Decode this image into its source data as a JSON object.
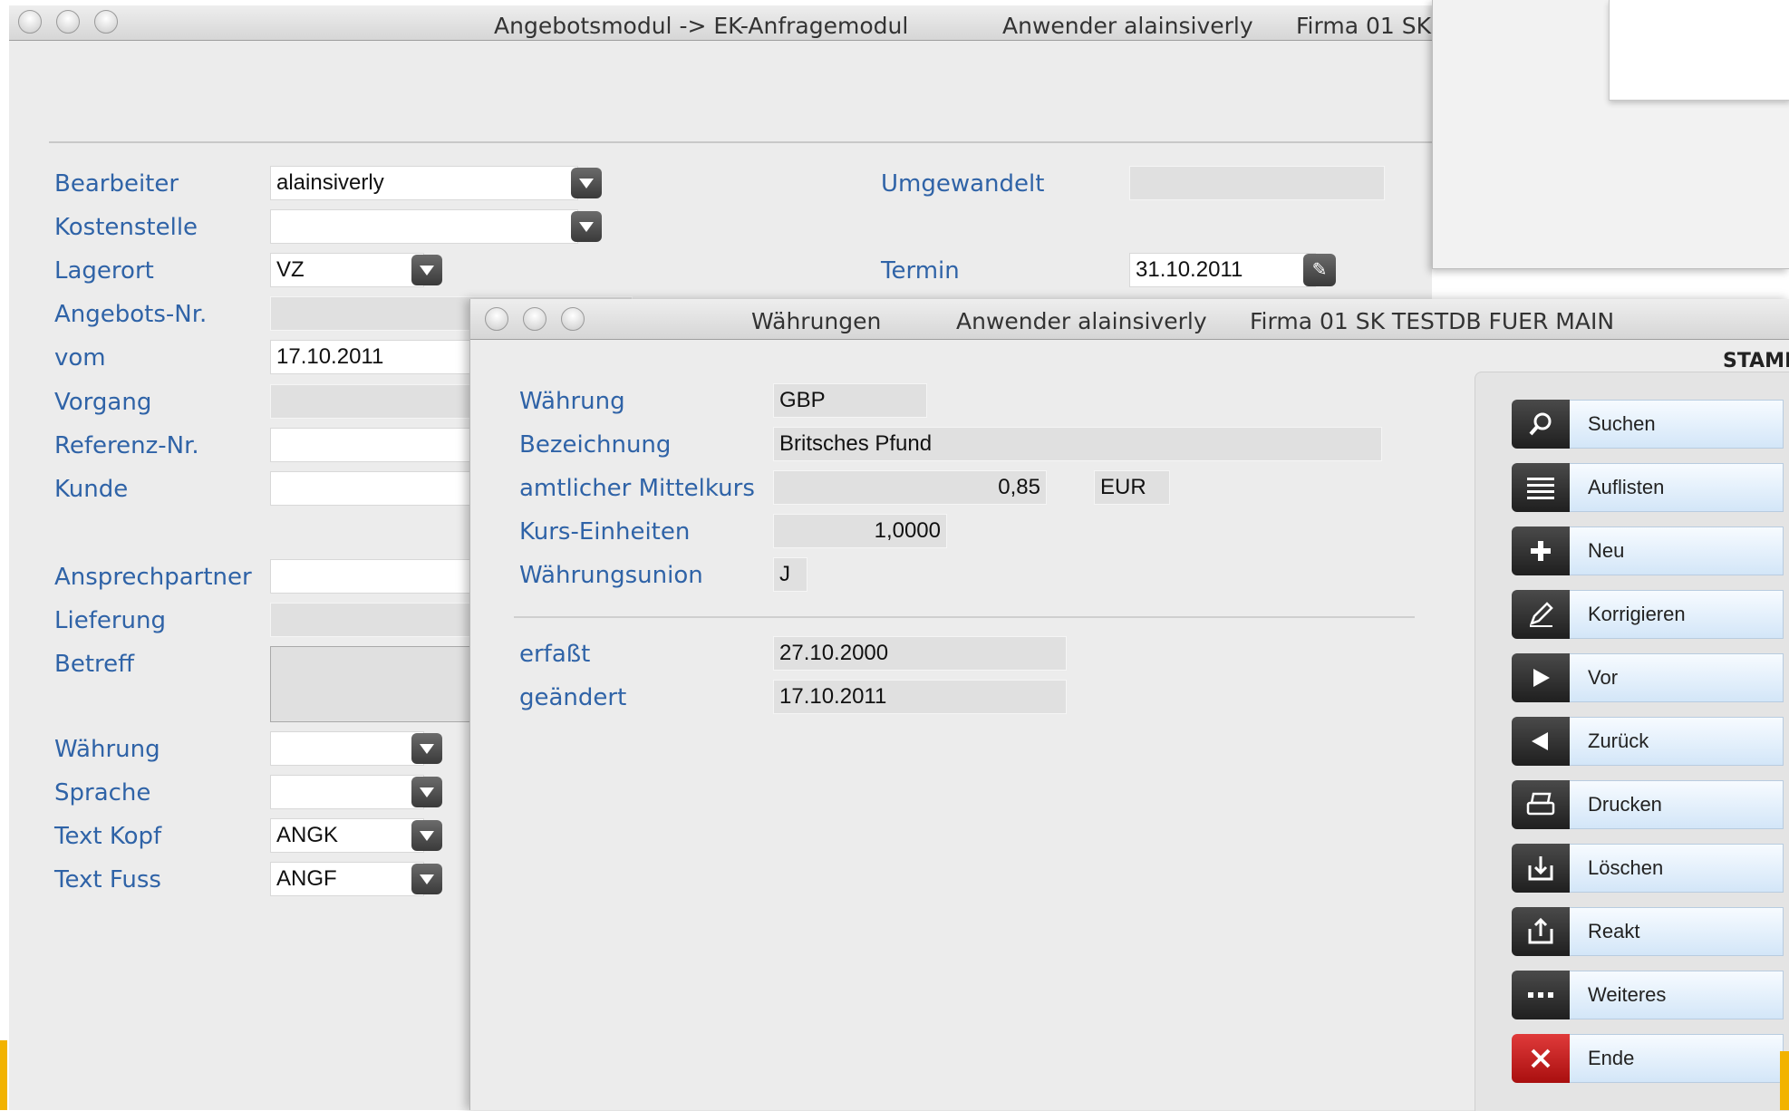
{
  "main_window": {
    "title": "Angebotsmodul -> EK-Anfragemodul",
    "user": "Anwender alainsiverly",
    "firm": "Firma 01 SK",
    "fields": {
      "bearbeiter": {
        "label": "Bearbeiter",
        "value": "alainsiverly"
      },
      "kostenstelle": {
        "label": "Kostenstelle",
        "value": ""
      },
      "lagerort": {
        "label": "Lagerort",
        "value": "VZ"
      },
      "angebots_nr": {
        "label": "Angebots-Nr.",
        "value": ""
      },
      "vom": {
        "label": "vom",
        "value": "17.10.2011"
      },
      "vorgang": {
        "label": "Vorgang",
        "value": ""
      },
      "referenz_nr": {
        "label": "Referenz-Nr.",
        "value": ""
      },
      "kunde": {
        "label": "Kunde",
        "value": ""
      },
      "ansprechpartner": {
        "label": "Ansprechpartner",
        "value": ""
      },
      "lieferung": {
        "label": "Lieferung",
        "value": ""
      },
      "betreff": {
        "label": "Betreff",
        "value": ""
      },
      "waehrung": {
        "label": "Währung",
        "value": ""
      },
      "sprache": {
        "label": "Sprache",
        "value": ""
      },
      "text_kopf": {
        "label": "Text Kopf",
        "value": "ANGK"
      },
      "text_fuss": {
        "label": "Text Fuss",
        "value": "ANGF"
      },
      "umgewandelt": {
        "label": "Umgewandelt",
        "value": ""
      },
      "termin": {
        "label": "Termin",
        "value": "31.10.2011"
      }
    }
  },
  "currency_window": {
    "title": "Währungen",
    "user": "Anwender alainsiverly",
    "firm": "Firma 01 SK TESTDB FUER MAIN",
    "section_header": "STAMI",
    "fields": {
      "waehrung": {
        "label": "Währung",
        "value": "GBP"
      },
      "bezeichnung": {
        "label": "Bezeichnung",
        "value": "Britsches Pfund"
      },
      "mittelkurs": {
        "label": "amtlicher Mittelkurs",
        "value": "0,85",
        "unit": "EUR"
      },
      "kurs_einheiten": {
        "label": "Kurs-Einheiten",
        "value": "1,0000"
      },
      "waehrungsunion": {
        "label": "Währungsunion",
        "value": "J"
      },
      "erfasst": {
        "label": "erfaßt",
        "value": "27.10.2000"
      },
      "geaendert": {
        "label": "geändert",
        "value": "17.10.2011"
      }
    },
    "buttons": [
      {
        "label": "Suchen",
        "icon": "search-icon"
      },
      {
        "label": "Auflisten",
        "icon": "list-icon"
      },
      {
        "label": "Neu",
        "icon": "plus-icon"
      },
      {
        "label": "Korrigieren",
        "icon": "pencil-icon"
      },
      {
        "label": "Vor",
        "icon": "play-right-icon"
      },
      {
        "label": "Zurück",
        "icon": "play-left-icon"
      },
      {
        "label": "Drucken",
        "icon": "printer-icon"
      },
      {
        "label": "Löschen",
        "icon": "download-tray-icon"
      },
      {
        "label": "Reakt",
        "icon": "upload-tray-icon"
      },
      {
        "label": "Weiteres",
        "icon": "more-dots-icon"
      },
      {
        "label": "Ende",
        "icon": "close-x-icon"
      }
    ]
  }
}
